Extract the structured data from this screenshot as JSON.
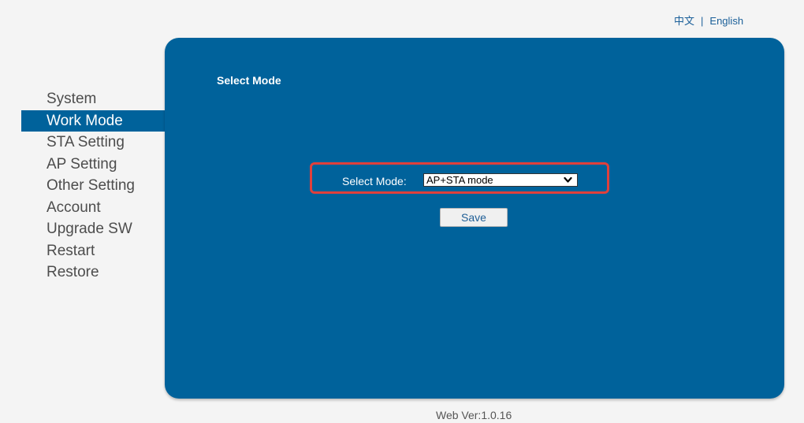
{
  "language": {
    "chinese_label": "中文",
    "separator": "|",
    "english_label": "English"
  },
  "sidebar": {
    "items": [
      {
        "label": "System"
      },
      {
        "label": "Work Mode"
      },
      {
        "label": "STA Setting"
      },
      {
        "label": "AP Setting"
      },
      {
        "label": "Other Setting"
      },
      {
        "label": "Account"
      },
      {
        "label": "Upgrade SW"
      },
      {
        "label": "Restart"
      },
      {
        "label": "Restore"
      }
    ],
    "active_index": 1
  },
  "main": {
    "section_title": "Select Mode",
    "mode_label": "Select Mode:",
    "mode_value": "AP+STA mode",
    "save_label": "Save"
  },
  "footer": {
    "version": "Web Ver:1.0.16"
  },
  "colors": {
    "panel_bg": "#00629b",
    "highlight_border": "#e0403c",
    "link": "#1a5f99"
  }
}
